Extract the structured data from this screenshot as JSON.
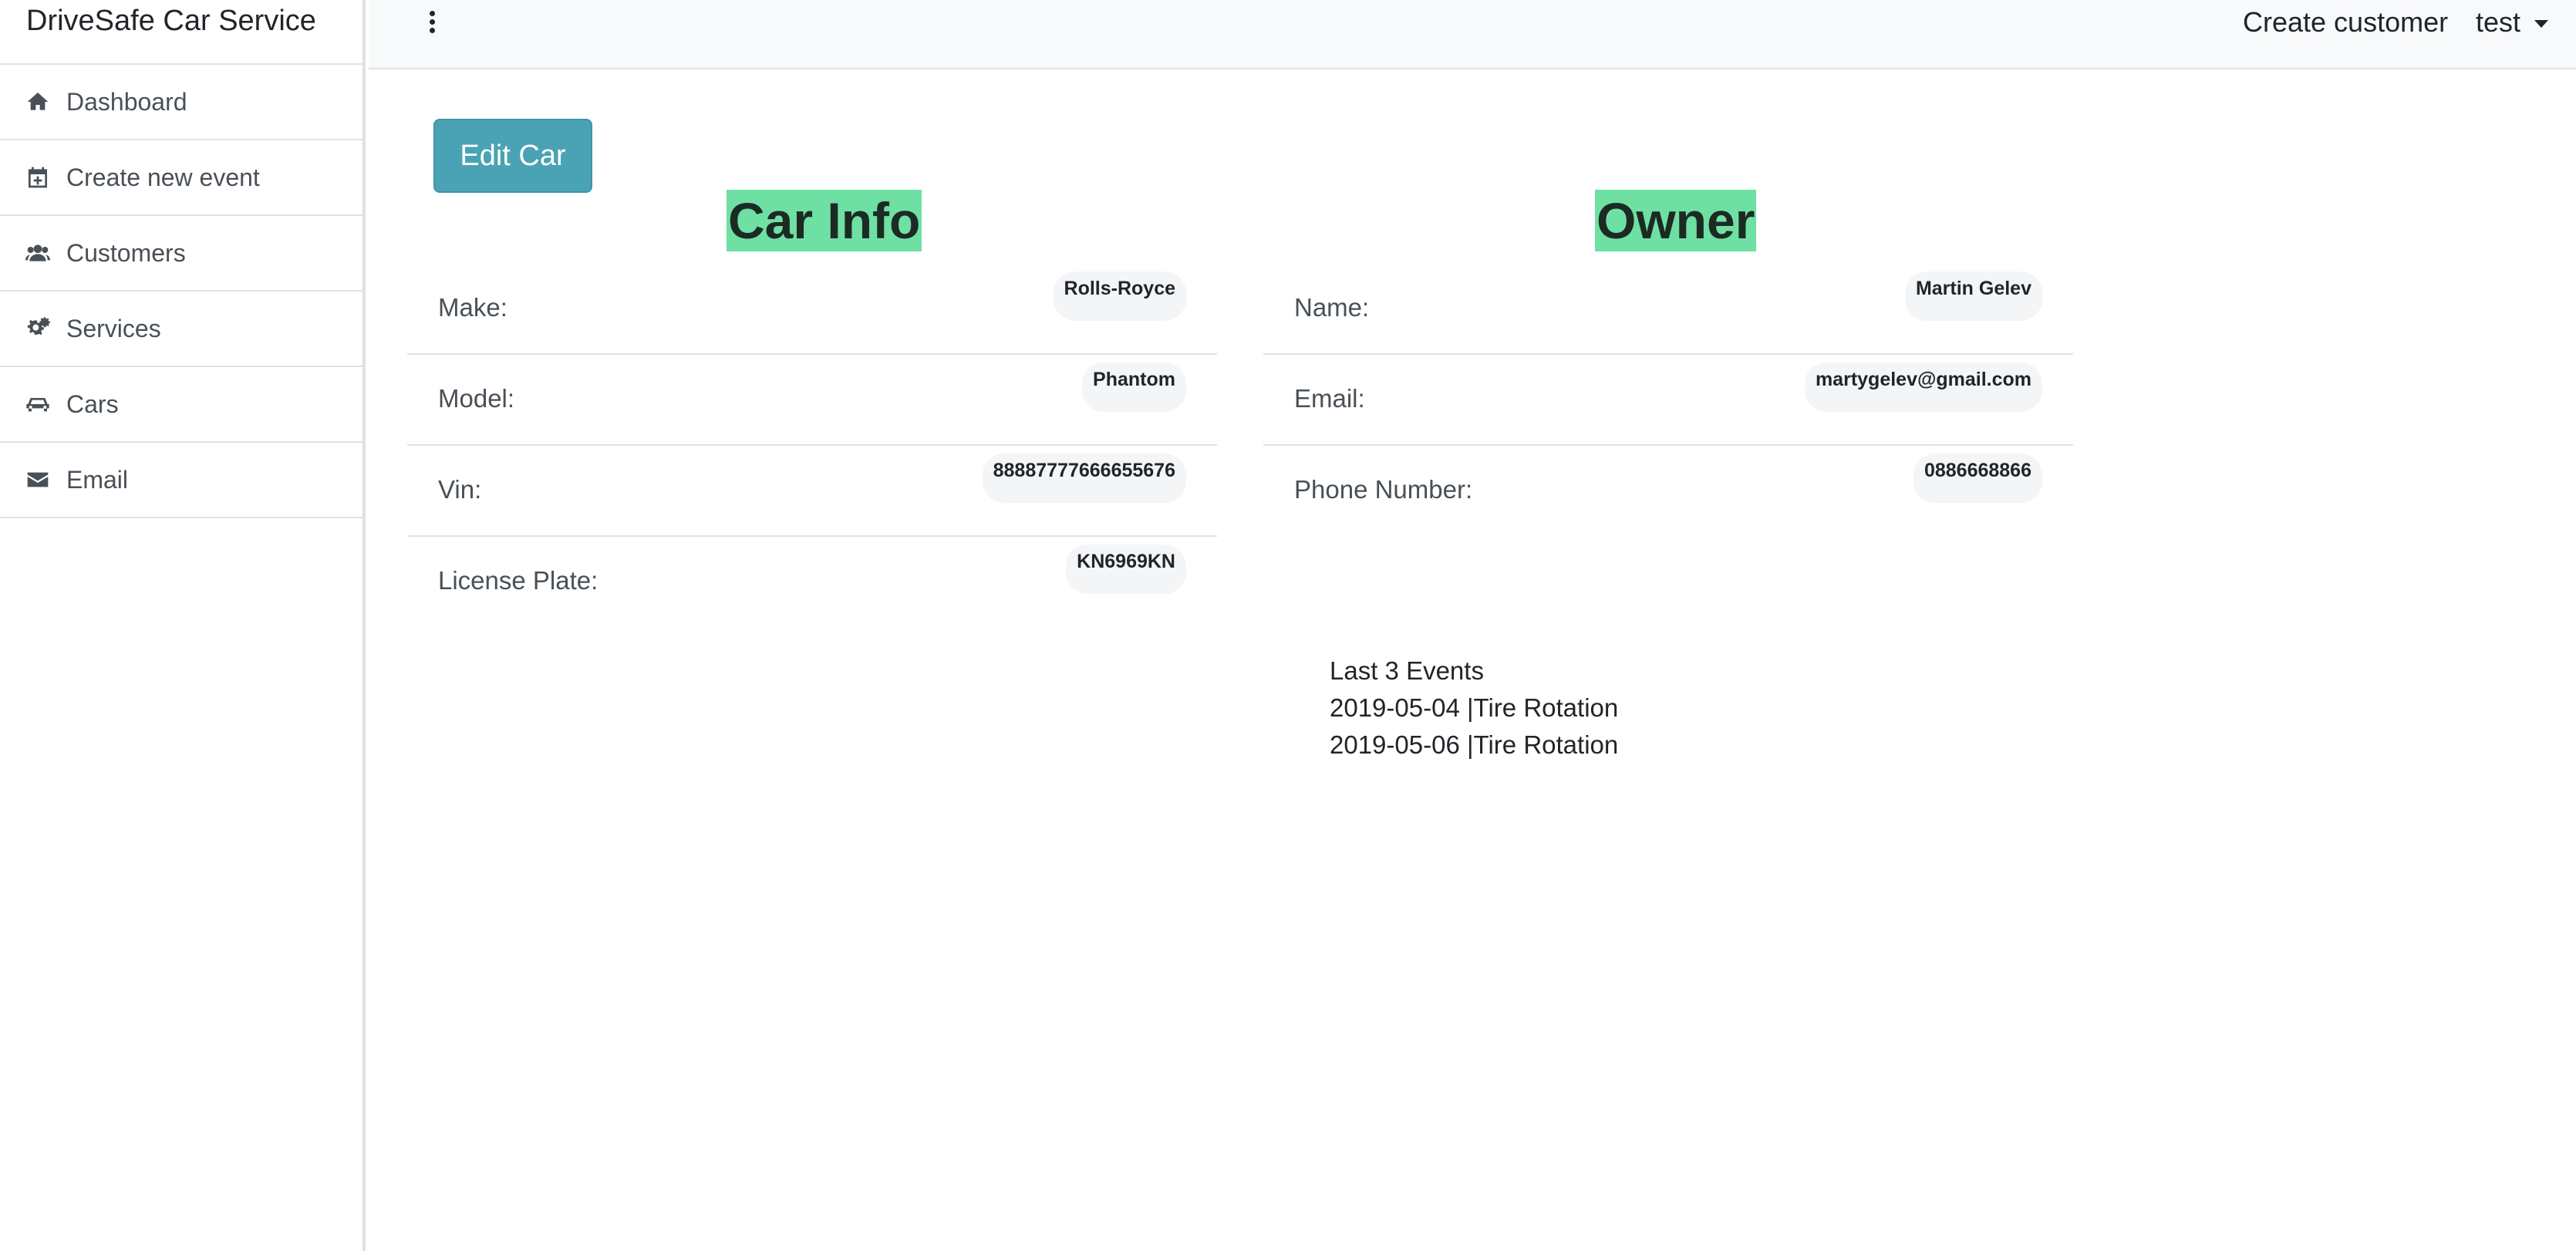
{
  "sidebar": {
    "brand": "DriveSafe Car Service",
    "items": [
      {
        "label": "Dashboard",
        "icon": "home-icon"
      },
      {
        "label": "Create new event",
        "icon": "calendar-plus-icon"
      },
      {
        "label": "Customers",
        "icon": "users-icon"
      },
      {
        "label": "Services",
        "icon": "cogs-icon"
      },
      {
        "label": "Cars",
        "icon": "car-icon"
      },
      {
        "label": "Email",
        "icon": "envelope-icon"
      }
    ]
  },
  "topbar": {
    "create_customer": "Create customer",
    "user": "test"
  },
  "main": {
    "edit_button": "Edit Car",
    "car_info": {
      "title": "Car Info",
      "rows": [
        {
          "label": "Make:",
          "value": "Rolls-Royce"
        },
        {
          "label": "Model:",
          "value": "Phantom"
        },
        {
          "label": "Vin:",
          "value": "88887777666655676"
        },
        {
          "label": "License Plate:",
          "value": "KN6969KN"
        }
      ]
    },
    "owner": {
      "title": "Owner",
      "rows": [
        {
          "label": "Name:",
          "value": "Martin Gelev"
        },
        {
          "label": "Email:",
          "value": "martygelev@gmail.com"
        },
        {
          "label": "Phone Number:",
          "value": "0886668866"
        }
      ]
    },
    "events": {
      "title": "Last 3 Events",
      "items": [
        "2019-05-04 |Tire Rotation",
        "2019-05-06 |Tire Rotation"
      ]
    }
  },
  "colors": {
    "accent_button": "#4aa3b4",
    "heading_highlight": "#6fe0a3",
    "topbar_bg": "#f8f9fa"
  }
}
